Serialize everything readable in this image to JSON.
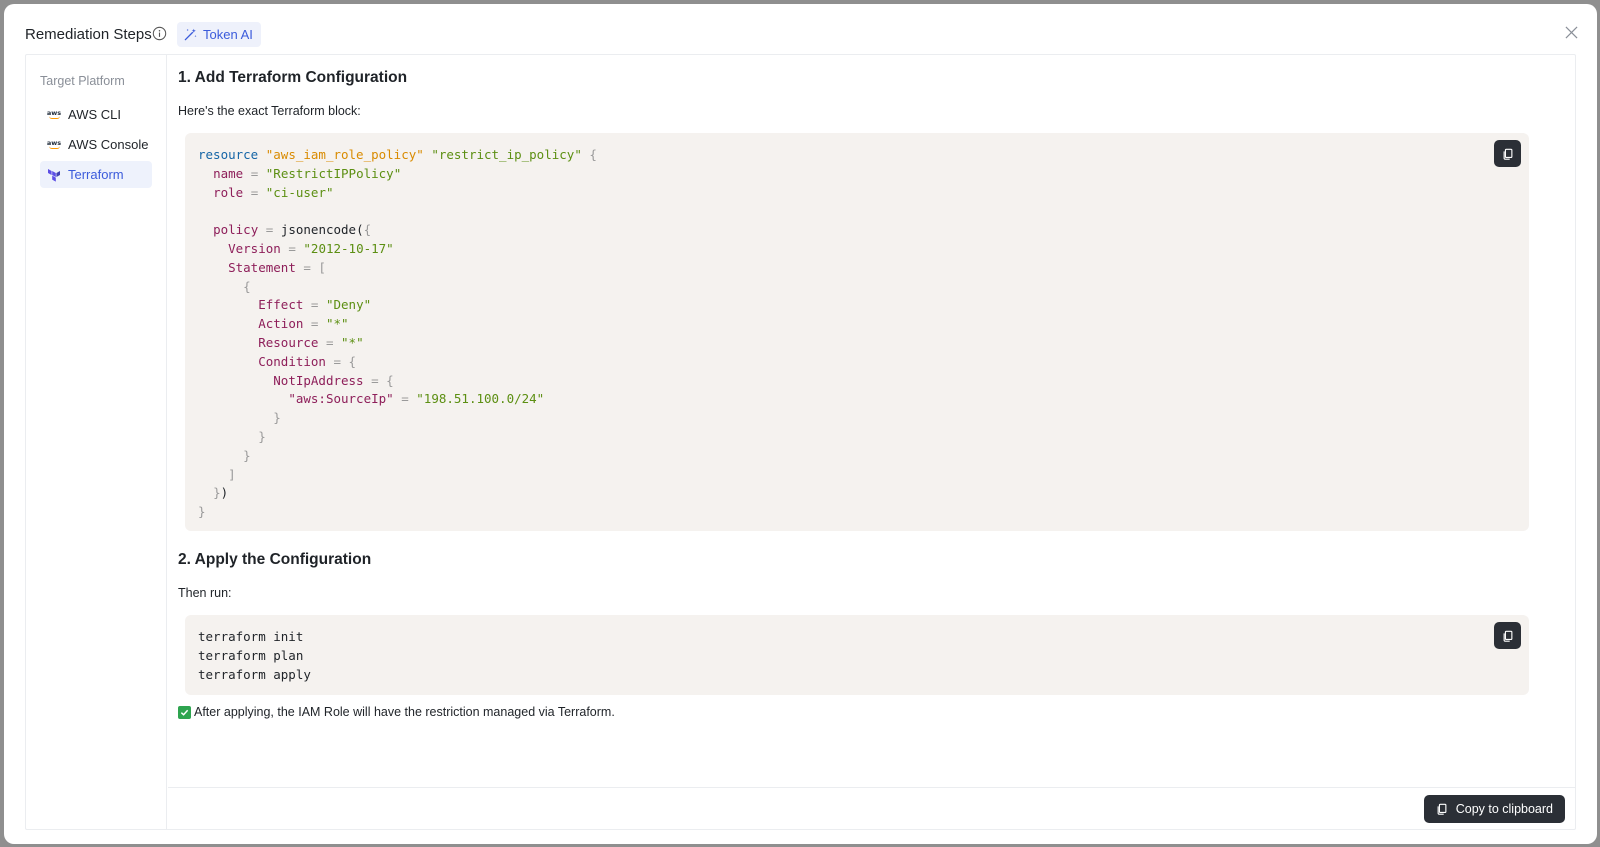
{
  "modal": {
    "title": "Remediation Steps",
    "ai_badge": "Token AI"
  },
  "sidebar": {
    "heading": "Target Platform",
    "items": [
      {
        "label": "AWS CLI",
        "icon": "aws-logo-icon",
        "logo_text": "aws",
        "active": false
      },
      {
        "label": "AWS Console",
        "icon": "aws-logo-icon",
        "logo_text": "aws",
        "active": false
      },
      {
        "label": "Terraform",
        "icon": "terraform-icon",
        "active": true
      }
    ]
  },
  "steps": [
    {
      "heading": "1. Add Terraform Configuration",
      "text": "Here's the exact Terraform block:",
      "code_lines": [
        "resource \"aws_iam_role_policy\" \"restrict_ip_policy\" {",
        "  name = \"RestrictIPPolicy\"",
        "  role = \"ci-user\"",
        "",
        "  policy = jsonencode({",
        "    Version = \"2012-10-17\"",
        "    Statement = [",
        "      {",
        "        Effect = \"Deny\"",
        "        Action = \"*\"",
        "        Resource = \"*\"",
        "        Condition = {",
        "          NotIpAddress = {",
        "            \"aws:SourceIp\" = \"198.51.100.0/24\"",
        "          }",
        "        }",
        "      }",
        "    ]",
        "  })",
        "}"
      ]
    },
    {
      "heading": "2. Apply the Configuration",
      "text": "Then run:",
      "code_lines": [
        "terraform init",
        "terraform plan",
        "terraform apply"
      ]
    }
  ],
  "success_message": "After applying, the IAM Role will have the restriction managed via Terraform.",
  "footer": {
    "copy_button": "Copy to clipboard"
  },
  "colors": {
    "accent": "#3b5bdb",
    "code_bg": "#f5f2ef",
    "dark_button": "#2b2f36",
    "success": "#2ea44f"
  }
}
